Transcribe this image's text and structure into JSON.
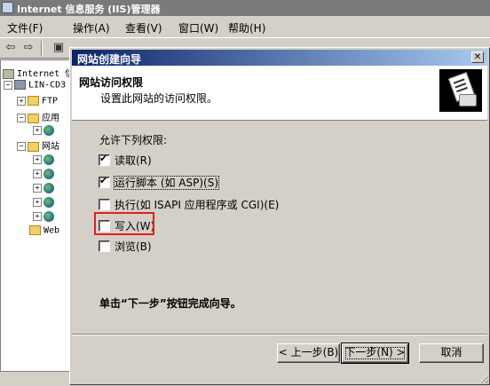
{
  "window": {
    "title": "Internet 信息服务 (IIS)管理器"
  },
  "menu": {
    "items": [
      "文件(F)",
      "操作(A)",
      "查看(V)",
      "窗口(W)",
      "帮助(H)"
    ]
  },
  "tree": {
    "items": [
      {
        "label": "Internet 信",
        "icon": "pc-icon"
      },
      {
        "label": "LIN-CD3",
        "icon": "server-icon"
      },
      {
        "label": "FTP",
        "icon": "folder-icon"
      },
      {
        "label": "应用",
        "icon": "folder-icon"
      },
      {
        "label": "网站",
        "icon": "folder-icon"
      },
      {
        "label": "Web",
        "icon": "folder-icon"
      }
    ]
  },
  "wizard": {
    "title": "网站创建向导",
    "header_title": "网站访问权限",
    "header_subtitle": "设置此网站的访问权限。",
    "intro": "允许下列权限:",
    "permissions": [
      {
        "label": "读取(R)",
        "checked": true
      },
      {
        "label": "运行脚本 (如 ASP)(S)",
        "checked": true
      },
      {
        "label": "执行(如 ISAPI 应用程序或 CGI)(E)",
        "checked": false
      },
      {
        "label": "写入(W)",
        "checked": false
      },
      {
        "label": "浏览(B)",
        "checked": false
      }
    ],
    "finish_note": "单击“下一步”按钮完成向导。",
    "buttons": {
      "back": "< 上一步(B)",
      "next": "下一步(N) >",
      "cancel": "取消"
    },
    "highlight_color": "#e0201c"
  }
}
